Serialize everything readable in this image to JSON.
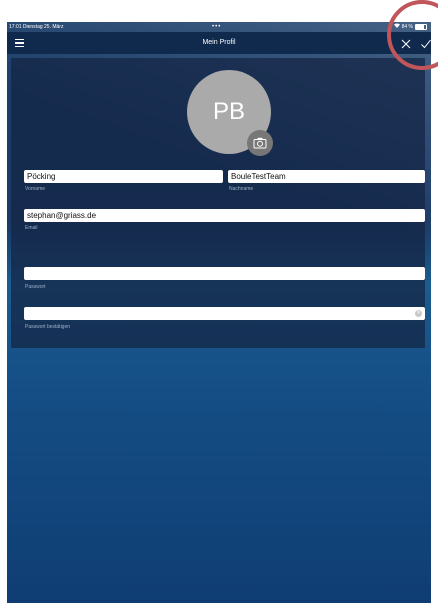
{
  "statusbar": {
    "time_date": "17:01  Dienstag 25. März",
    "dots": "•••",
    "battery": "84 %"
  },
  "navbar": {
    "title": "Mein Profil",
    "menu_icon": "hamburger-menu-icon",
    "close_icon": "close-icon",
    "confirm_icon": "checkmark-icon"
  },
  "profile": {
    "initials": "PB",
    "camera_icon": "camera-icon",
    "fields": {
      "first_name": {
        "value": "Pöcking",
        "label": "Vorname"
      },
      "last_name": {
        "value": "BouleTestTeam",
        "label": "Nachname"
      },
      "email": {
        "value": "stephan@griass.de",
        "label": "Email"
      },
      "password": {
        "value": "",
        "label": "Passwort"
      },
      "password_confirm": {
        "value": "",
        "label": "Passwort bestätigen",
        "clear_icon": "clear-icon"
      }
    }
  },
  "colors": {
    "navbar": "#0f2a4d",
    "avatar": "#aaaaaa",
    "highlight_circle": "#c0565a"
  }
}
